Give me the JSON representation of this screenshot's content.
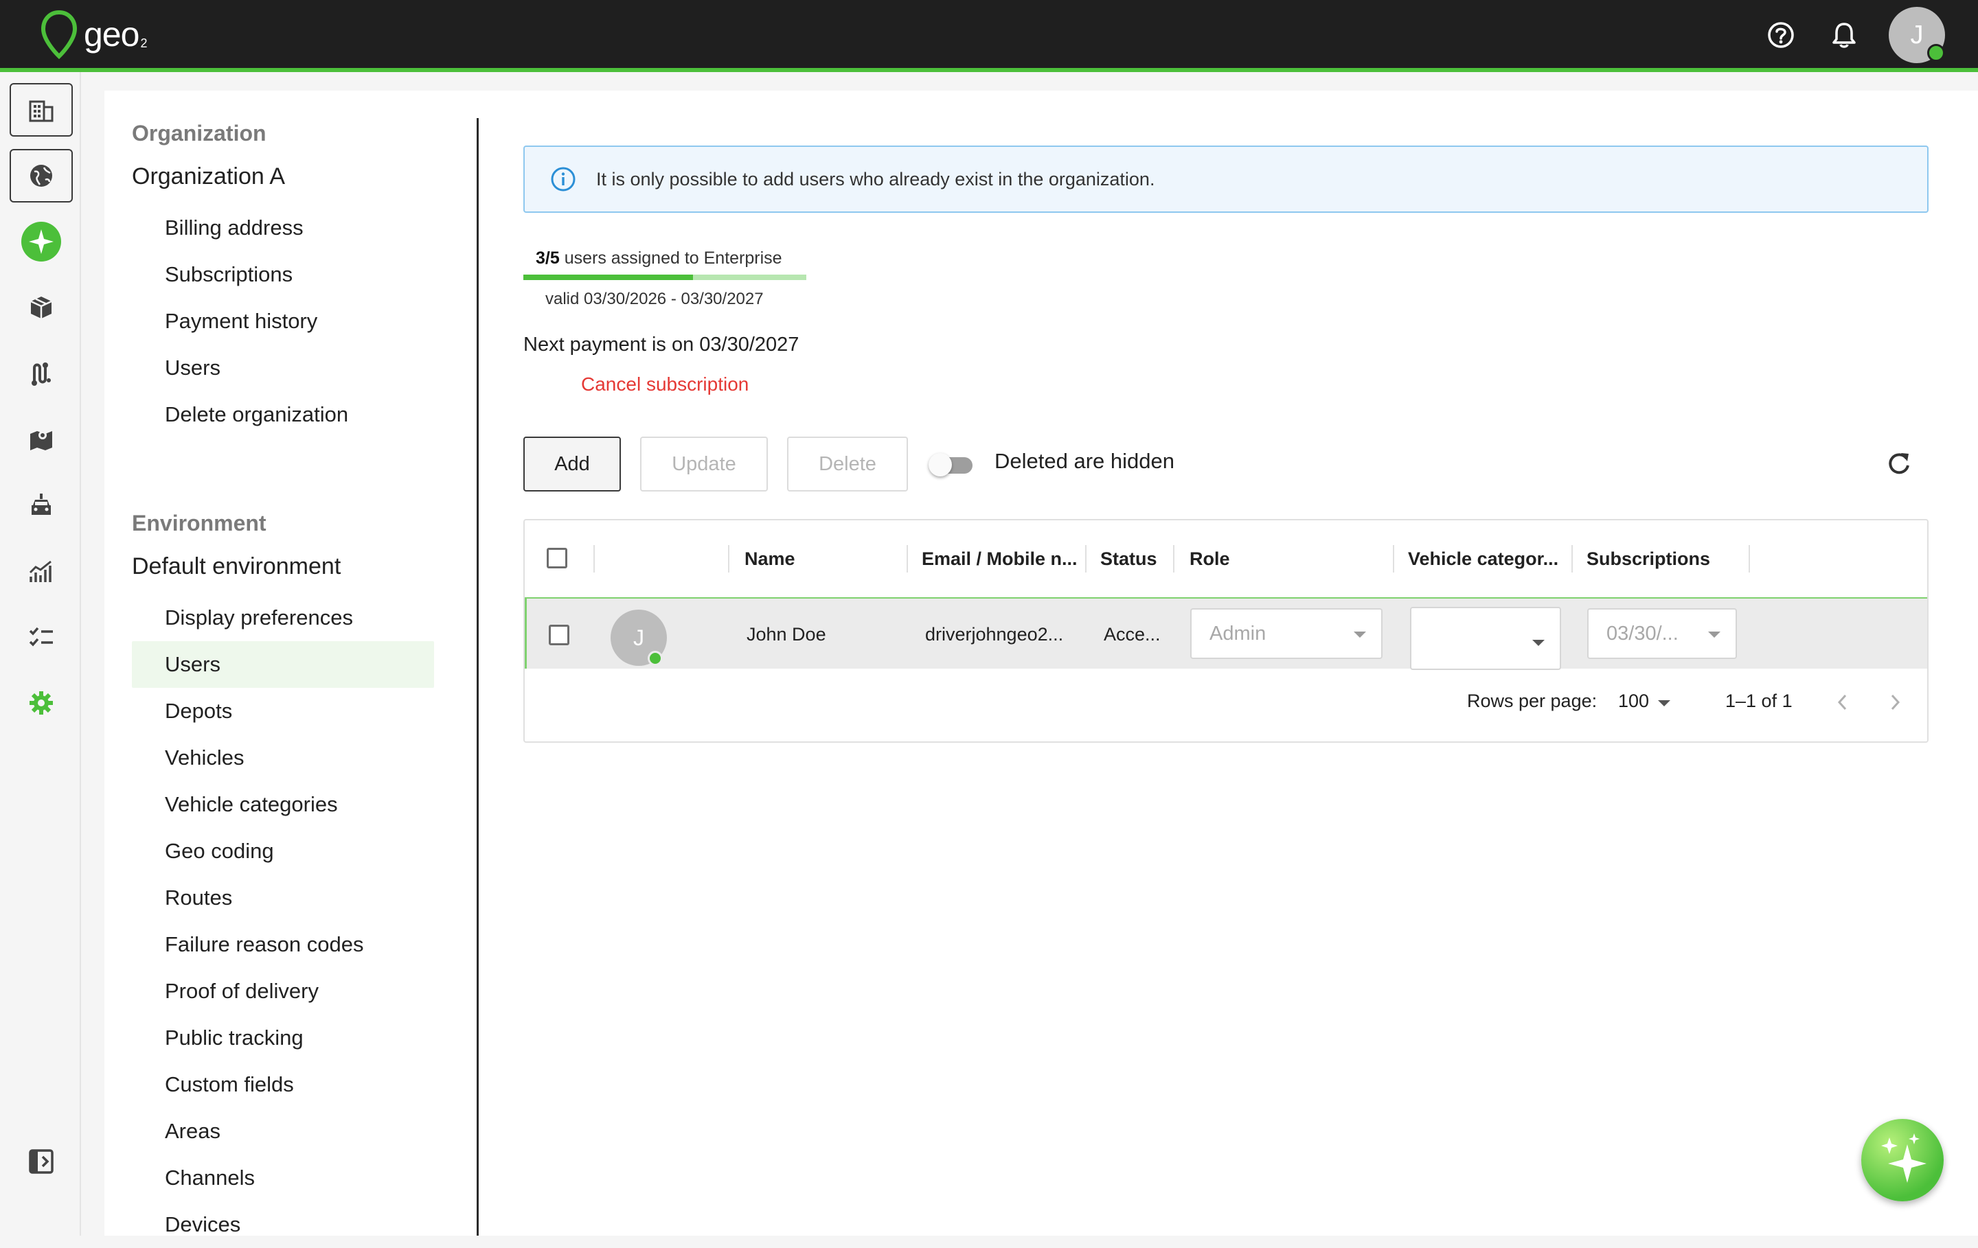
{
  "app": {
    "logo_text": "geo",
    "logo_sub": "2",
    "user_initial": "J",
    "colors": {
      "brand_green": "#4cbf3a",
      "topbar": "#1f1f1f",
      "danger": "#e53935",
      "info_border": "#8ec8ef"
    }
  },
  "topbar": {
    "icons": [
      "help-circle-icon",
      "bell-icon"
    ]
  },
  "rail": {
    "items": [
      "organization-icon",
      "globe-icon",
      "ai-sparkle-icon",
      "package-icon",
      "route-icon",
      "map-icon",
      "vehicle-icon",
      "analytics-icon",
      "checklist-icon",
      "settings-icon",
      "collapse-panel-icon"
    ]
  },
  "subnav": {
    "org_heading": "Organization",
    "org_name": "Organization A",
    "org_items": [
      "Billing address",
      "Subscriptions",
      "Payment history",
      "Users",
      "Delete organization"
    ],
    "env_heading": "Environment",
    "env_name": "Default environment",
    "env_items": [
      "Display preferences",
      "Users",
      "Depots",
      "Vehicles",
      "Vehicle categories",
      "Geo coding",
      "Routes",
      "Failure reason codes",
      "Proof of delivery",
      "Public tracking",
      "Custom fields",
      "Areas",
      "Channels",
      "Devices"
    ],
    "active_env_item": "Users"
  },
  "main": {
    "info_text": "It is only possible to add users who already exist in the organization.",
    "assigned_count": "3/5",
    "assigned_text": "users assigned to Enterprise",
    "assigned_fraction": 0.6,
    "valid_text": "valid 03/30/2026 - 03/30/2027",
    "next_payment": "Next payment is on 03/30/2027",
    "cancel_label": "Cancel subscription",
    "buttons": {
      "add": "Add",
      "update": "Update",
      "delete": "Delete"
    },
    "toggle_label": "Deleted are hidden",
    "toggle_on": false
  },
  "table": {
    "columns": [
      "Name",
      "Email / Mobile n...",
      "Status",
      "Role",
      "Vehicle categor...",
      "Subscriptions"
    ],
    "rows": [
      {
        "initial": "J",
        "name": "John Doe",
        "email": "driverjohngeo2...",
        "status": "Acce...",
        "role": "Admin",
        "vehicle_category": "",
        "subscription": "03/30/..."
      }
    ],
    "rows_per_page_label": "Rows per page:",
    "rows_per_page": "100",
    "range": "1–1 of 1"
  }
}
